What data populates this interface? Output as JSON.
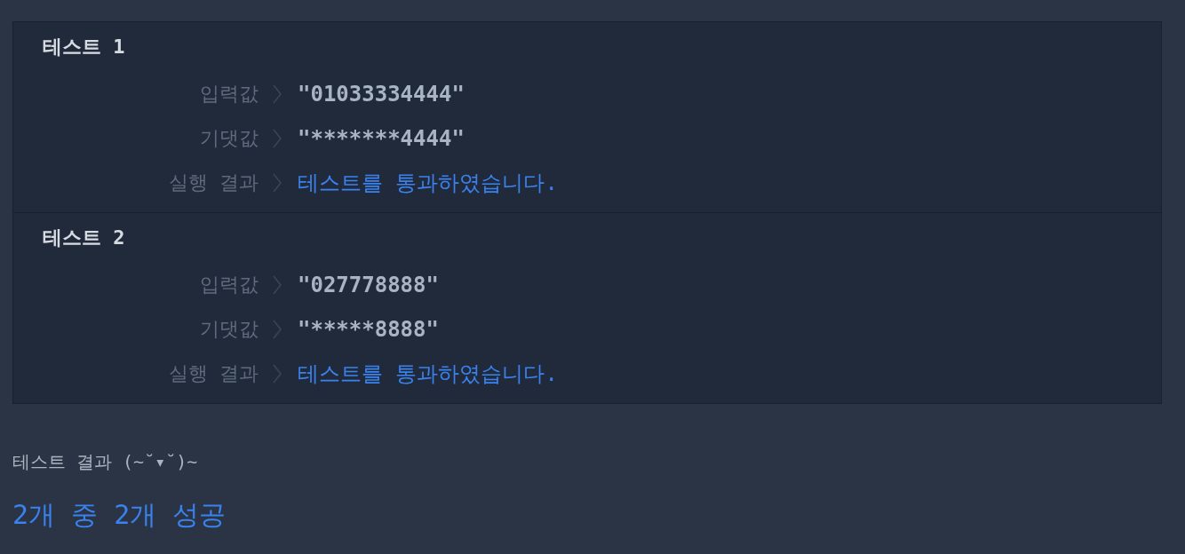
{
  "tests": [
    {
      "title": "테스트 1",
      "rows": [
        {
          "kind": "value",
          "label": "입력값",
          "value": "\"01033334444\""
        },
        {
          "kind": "value",
          "label": "기댓값",
          "value": "\"*******4444\""
        },
        {
          "kind": "result",
          "label": "실행 결과",
          "value": "테스트를 통과하였습니다.",
          "passed": true
        }
      ]
    },
    {
      "title": "테스트 2",
      "rows": [
        {
          "kind": "value",
          "label": "입력값",
          "value": "\"027778888\""
        },
        {
          "kind": "value",
          "label": "기댓값",
          "value": "\"*****8888\""
        },
        {
          "kind": "result",
          "label": "실행 결과",
          "value": "테스트를 통과하였습니다.",
          "passed": true
        }
      ]
    }
  ],
  "summary": {
    "heading": "테스트 결과 (~˘▾˘)~",
    "result": "2개 중 2개 성공"
  }
}
